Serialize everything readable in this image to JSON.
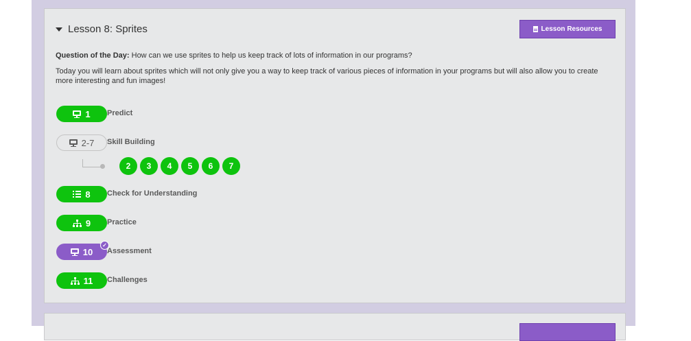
{
  "lesson": {
    "title": "Lesson 8: Sprites",
    "resources_label": "Lesson Resources",
    "qotd_label": "Question of the Day:",
    "qotd_text": " How can we use sprites to help us keep track of lots of information in our programs?",
    "description": "Today you will learn about sprites which will not only give you a way to keep track of various pieces of information in your programs but will also allow you to create more interesting and fun images!"
  },
  "levels": [
    {
      "number": "1",
      "label": "Predict",
      "icon": "monitor-icon",
      "style": "green"
    },
    {
      "number": "2-7",
      "label": "Skill Building",
      "icon": "monitor-icon",
      "style": "outline"
    },
    {
      "number": "8",
      "label": "Check for Understanding",
      "icon": "list-icon",
      "style": "green"
    },
    {
      "number": "9",
      "label": "Practice",
      "icon": "hierarchy-icon",
      "style": "green"
    },
    {
      "number": "10",
      "label": "Assessment",
      "icon": "monitor-icon",
      "style": "purple",
      "completed": true
    },
    {
      "number": "11",
      "label": "Challenges",
      "icon": "hierarchy-icon",
      "style": "green"
    }
  ],
  "sublevels": [
    "2",
    "3",
    "4",
    "5",
    "6",
    "7"
  ],
  "colors": {
    "green": "#0ec30e",
    "purple": "#8b5cc8",
    "background": "#d2cde2",
    "card": "#e7e8e9"
  }
}
